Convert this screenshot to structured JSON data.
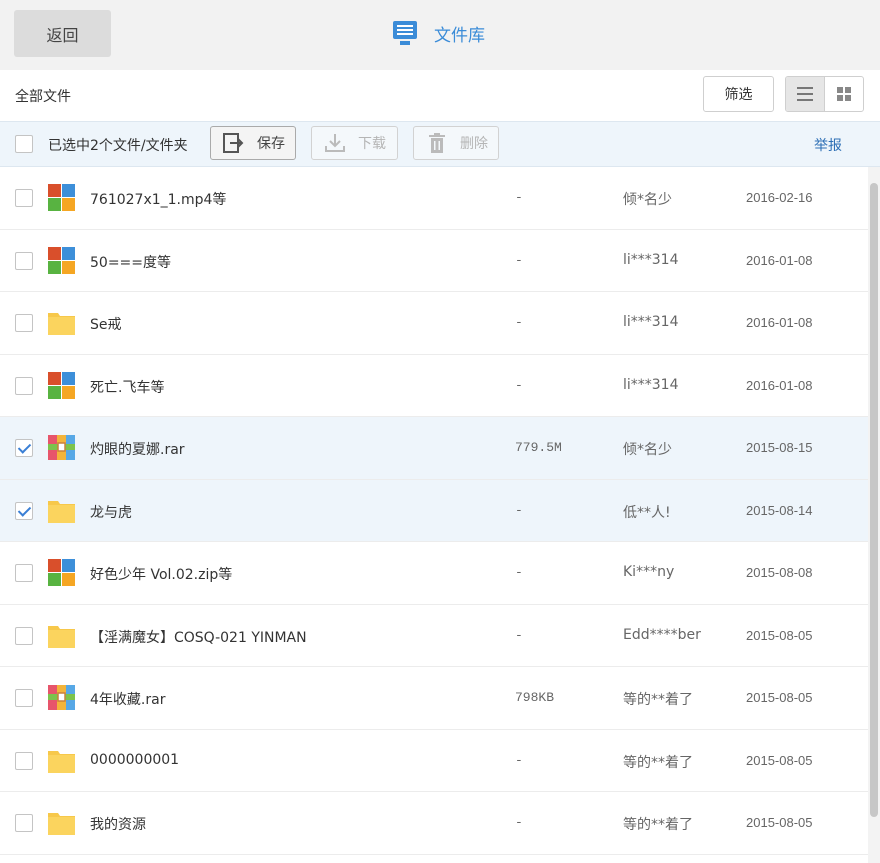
{
  "header": {
    "back_label": "返回",
    "title": "文件库",
    "title_icon": "file-library-icon",
    "accent": "#3b8cd8"
  },
  "subbar": {
    "all_files_label": "全部文件",
    "filter_label": "筛选",
    "view_modes": [
      "list-view-icon",
      "grid-view-icon"
    ],
    "active_view": "list"
  },
  "actionbar": {
    "selection_text": "已选中2个文件/文件夹",
    "save_label": "保存",
    "download_label": "下载",
    "delete_label": "删除",
    "report_label": "举报"
  },
  "files": [
    {
      "name": "761027x1_1.mp4等",
      "size": "-",
      "owner": "倾*名少",
      "date": "2016-02-16",
      "type": "multi",
      "checked": false
    },
    {
      "name": "50===度等",
      "size": "-",
      "owner": "li***314",
      "date": "2016-01-08",
      "type": "multi",
      "checked": false
    },
    {
      "name": "Se戒",
      "size": "-",
      "owner": "li***314",
      "date": "2016-01-08",
      "type": "folder",
      "checked": false
    },
    {
      "name": "死亡.飞车等",
      "size": "-",
      "owner": "li***314",
      "date": "2016-01-08",
      "type": "multi",
      "checked": false
    },
    {
      "name": "灼眼的夏娜.rar",
      "size": "779.5M",
      "owner": "倾*名少",
      "date": "2015-08-15",
      "type": "archive",
      "checked": true
    },
    {
      "name": "龙与虎",
      "size": "-",
      "owner": "低**人!",
      "date": "2015-08-14",
      "type": "folder",
      "checked": true
    },
    {
      "name": "好色少年 Vol.02.zip等",
      "size": "-",
      "owner": "Ki***ny",
      "date": "2015-08-08",
      "type": "multi",
      "checked": false
    },
    {
      "name": "【淫满魔女】COSQ-021 YINMAN",
      "size": "-",
      "owner": "Edd****ber",
      "date": "2015-08-05",
      "type": "folder",
      "checked": false
    },
    {
      "name": "4年收藏.rar",
      "size": "798KB",
      "owner": "等的**着了",
      "date": "2015-08-05",
      "type": "archive",
      "checked": false
    },
    {
      "name": "0000000001",
      "size": "-",
      "owner": "等的**着了",
      "date": "2015-08-05",
      "type": "folder",
      "checked": false
    },
    {
      "name": "我的资源",
      "size": "-",
      "owner": "等的**着了",
      "date": "2015-08-05",
      "type": "folder",
      "checked": false
    }
  ]
}
